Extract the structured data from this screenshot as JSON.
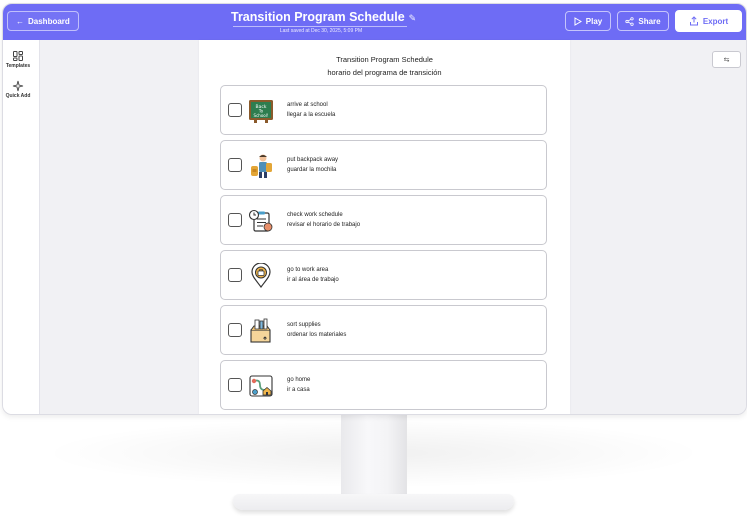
{
  "topbar": {
    "dashboard_label": "Dashboard",
    "title": "Transition Program Schedule",
    "last_saved": "Last saved at Dec 30, 2025, 5:09 PM",
    "play_label": "Play",
    "share_label": "Share",
    "export_label": "Export",
    "accent_color": "#6e6cf5"
  },
  "sidebar": {
    "items": [
      {
        "label": "Templates",
        "icon": "templates-grid-icon"
      },
      {
        "label": "Quick Add",
        "icon": "quick-add-sparkle-icon"
      }
    ]
  },
  "document": {
    "title": "Transition Program Schedule",
    "subtitle": "horario del programa de transición",
    "rows": [
      {
        "en": "arrive at school",
        "es": "llegar a la escuela",
        "icon": "back-to-school-chalkboard-icon",
        "icon_text": "Back To School!",
        "checked": false
      },
      {
        "en": "put backpack away",
        "es": "guardar la mochila",
        "icon": "student-backpack-icon",
        "checked": false
      },
      {
        "en": "check work schedule",
        "es": "revisar el horario de trabajo",
        "icon": "work-schedule-clipboard-icon",
        "checked": false
      },
      {
        "en": "go to work area",
        "es": "ir al área de trabajo",
        "icon": "work-area-location-pin-icon",
        "checked": false
      },
      {
        "en": "sort supplies",
        "es": "ordenar los materiales",
        "icon": "supplies-box-icon",
        "checked": false
      },
      {
        "en": "go home",
        "es": "ir a casa",
        "icon": "go-home-route-icon",
        "checked": false
      }
    ]
  }
}
